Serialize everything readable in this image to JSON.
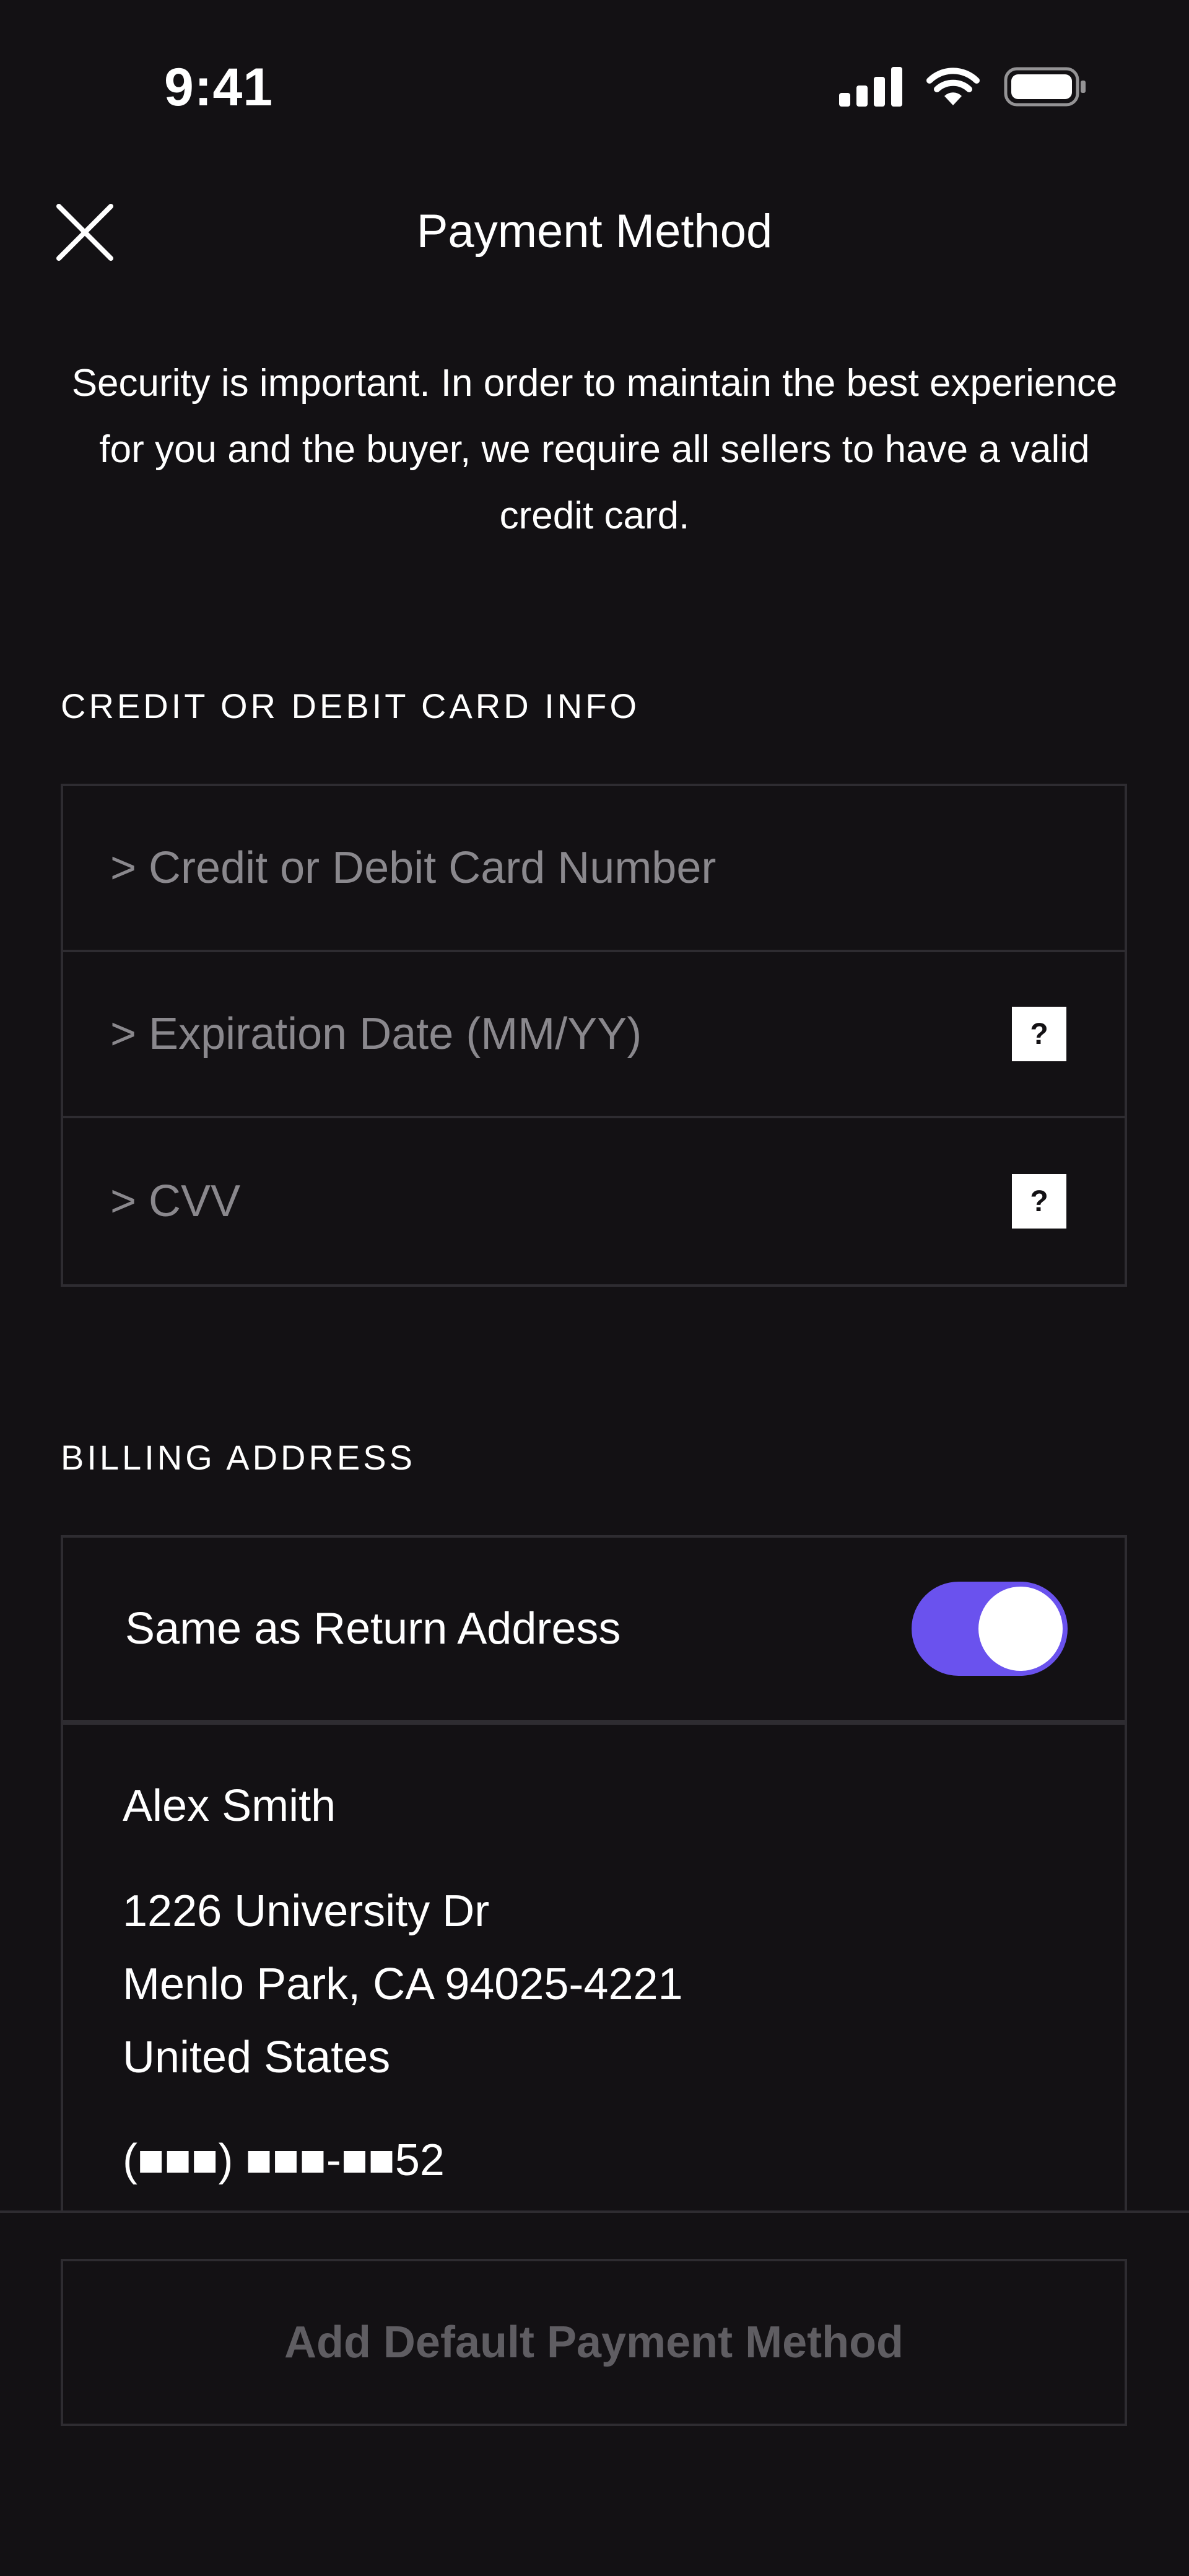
{
  "status_bar": {
    "time": "9:41",
    "icons": [
      "cellular-signal-icon",
      "wifi-icon",
      "battery-icon"
    ]
  },
  "header": {
    "title": "Payment Method",
    "close_icon": "close-icon"
  },
  "intro": {
    "text": "Security is important. In order to maintain the best experience for you and the buyer, we require all sellers to have a valid credit card."
  },
  "card_section": {
    "label": "CREDIT OR DEBIT CARD INFO",
    "fields": [
      {
        "placeholder": "> Credit or Debit Card Number",
        "value": "",
        "has_help": false
      },
      {
        "placeholder": "> Expiration Date (MM/YY)",
        "value": "",
        "has_help": true,
        "help_label": "?"
      },
      {
        "placeholder": "> CVV",
        "value": "",
        "has_help": true,
        "help_label": "?"
      }
    ]
  },
  "billing_section": {
    "label": "BILLING ADDRESS",
    "same_as_return": {
      "label": "Same as Return Address",
      "enabled": true
    },
    "address": {
      "name": "Alex Smith",
      "street": "1226 University Dr",
      "city_line": "Menlo Park, CA 94025-4221",
      "country": "United States",
      "phone": "(■■■) ■■■-■■52"
    }
  },
  "footer": {
    "button_label": "Add Default Payment Method"
  },
  "colors": {
    "background": "#131114",
    "border": "#2e2c31",
    "accent": "#6a52ee",
    "placeholder": "#8a888d",
    "disabled_text": "#5f5d62"
  }
}
